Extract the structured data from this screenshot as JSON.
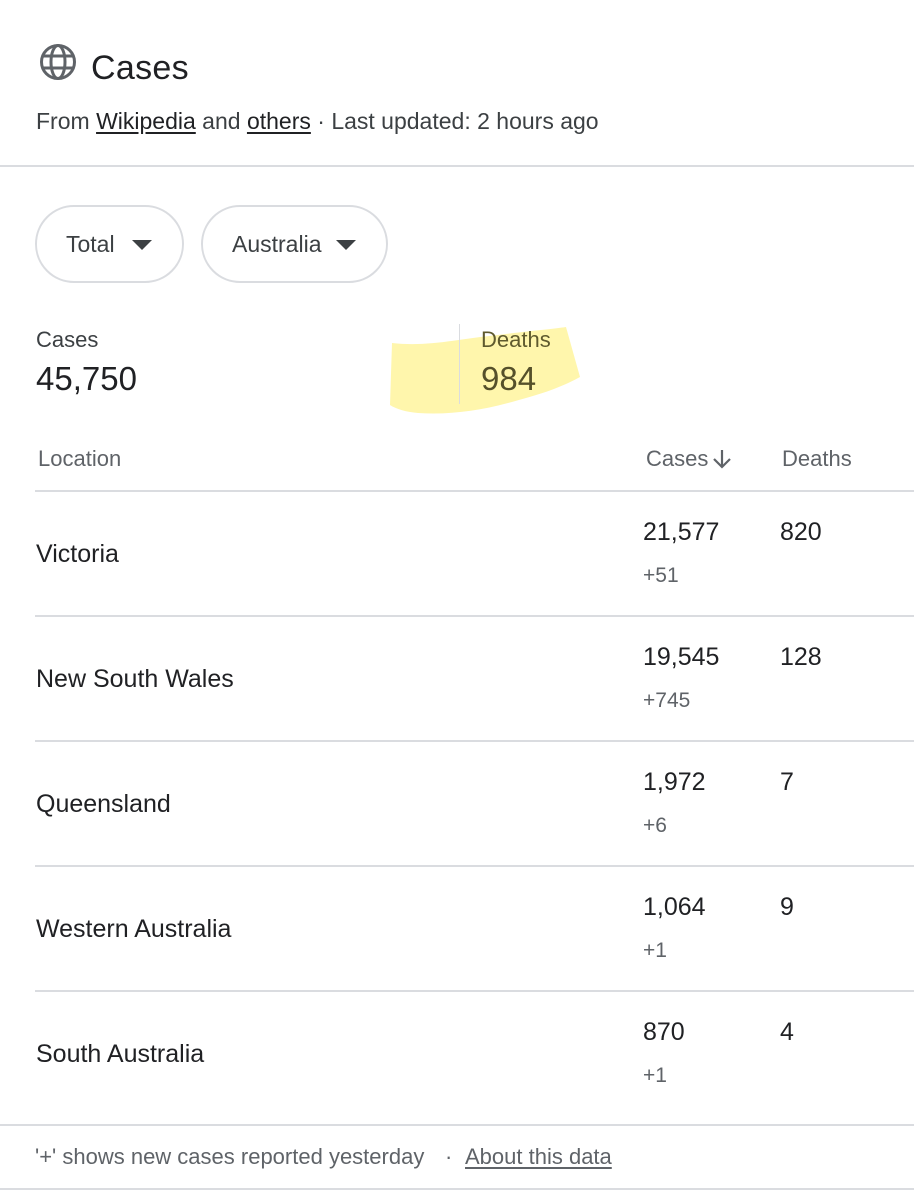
{
  "header": {
    "icon": "globe-icon",
    "title": "Cases",
    "source_prefix": "From",
    "source_link_1": "Wikipedia",
    "source_and": "and",
    "source_link_2": "others",
    "source_suffix": "· Last updated: 2 hours ago"
  },
  "filters": {
    "metric": "Total",
    "region": "Australia"
  },
  "summary": {
    "cases_label": "Cases",
    "cases_value": "45,750",
    "deaths_label": "Deaths",
    "deaths_value": "984",
    "highlight_color": "#fff59d"
  },
  "table": {
    "headers": {
      "location": "Location",
      "cases": "Cases",
      "deaths": "Deaths"
    },
    "sort_icon": "arrow-down-icon",
    "rows": [
      {
        "location": "Victoria",
        "cases": "21,577",
        "new": "+51",
        "deaths": "820"
      },
      {
        "location": "New South Wales",
        "cases": "19,545",
        "new": "+745",
        "deaths": "128"
      },
      {
        "location": "Queensland",
        "cases": "1,972",
        "new": "+6",
        "deaths": "7"
      },
      {
        "location": "Western Australia",
        "cases": "1,064",
        "new": "+1",
        "deaths": "9"
      },
      {
        "location": "South Australia",
        "cases": "870",
        "new": "+1",
        "deaths": "4"
      }
    ]
  },
  "footer": {
    "note": "'+' shows new cases reported yesterday",
    "separator": "·",
    "link": "About this data"
  }
}
